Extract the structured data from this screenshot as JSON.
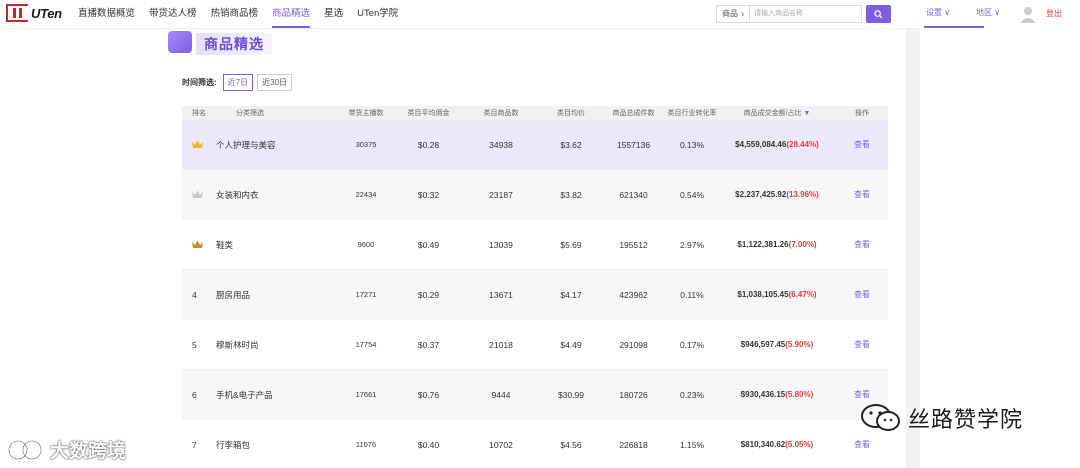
{
  "header": {
    "logo": "UTen",
    "nav": [
      "直播数据概览",
      "带货达人榜",
      "热销商品榜",
      "商品精选",
      "星选",
      "UTen学院"
    ],
    "nav_active_index": 3,
    "search_category": "商品",
    "search_placeholder": "请输入商品名称",
    "settings": "设置",
    "region": "地区",
    "logout": "登出"
  },
  "banner": {
    "title": "商品精选"
  },
  "time_filter": {
    "label": "时间筛选:",
    "options": [
      "近7日",
      "近30日"
    ],
    "active": "近7日"
  },
  "table": {
    "headers": [
      "排名",
      "分类筛选",
      "带货主播数",
      "类目平均佣金",
      "类目商品数",
      "类目均价",
      "商品总成件数",
      "类目行业转化率",
      "商品成交金额/占比",
      "操作"
    ],
    "rows": [
      {
        "rank": "",
        "rank_icon": "gold-crown-icon",
        "category": "个人护理与美容",
        "anchors": "30375",
        "commission": "$0.28",
        "goods": "34938",
        "avg_price": "$3.62",
        "units": "1557136",
        "conversion": "0.13%",
        "gmv": "$4,559,084.46",
        "share": "(28.44%)",
        "action": "查看"
      },
      {
        "rank": "",
        "rank_icon": "silver-crown-icon",
        "category": "女装和内衣",
        "anchors": "22434",
        "commission": "$0.32",
        "goods": "23187",
        "avg_price": "$3.82",
        "units": "621340",
        "conversion": "0.54%",
        "gmv": "$2,237,425.92",
        "share": "(13.96%)",
        "action": "查看"
      },
      {
        "rank": "",
        "rank_icon": "bronze-crown-icon",
        "category": "鞋类",
        "anchors": "9600",
        "commission": "$0.49",
        "goods": "13039",
        "avg_price": "$5.69",
        "units": "195512",
        "conversion": "2.97%",
        "gmv": "$1,122,381.26",
        "share": "(7.00%)",
        "action": "查看"
      },
      {
        "rank": "4",
        "rank_icon": "",
        "category": "厨房用品",
        "anchors": "17271",
        "commission": "$0.29",
        "goods": "13671",
        "avg_price": "$4.17",
        "units": "423962",
        "conversion": "0.11%",
        "gmv": "$1,038,105.45",
        "share": "(6.47%)",
        "action": "查看"
      },
      {
        "rank": "5",
        "rank_icon": "",
        "category": "穆斯林时尚",
        "anchors": "17754",
        "commission": "$0.37",
        "goods": "21018",
        "avg_price": "$4.49",
        "units": "291098",
        "conversion": "0.17%",
        "gmv": "$946,597.45",
        "share": "(5.90%)",
        "action": "查看"
      },
      {
        "rank": "6",
        "rank_icon": "",
        "category": "手机&电子产品",
        "anchors": "17661",
        "commission": "$0.76",
        "goods": "9444",
        "avg_price": "$30.99",
        "units": "180726",
        "conversion": "0.23%",
        "gmv": "$930,436.15",
        "share": "(5.80%)",
        "action": "查看"
      },
      {
        "rank": "7",
        "rank_icon": "",
        "category": "行李箱包",
        "anchors": "11076",
        "commission": "$0.40",
        "goods": "10702",
        "avg_price": "$4.56",
        "units": "226818",
        "conversion": "1.15%",
        "gmv": "$810,340.62",
        "share": "(5.05%)",
        "action": "查看"
      }
    ]
  },
  "watermarks": {
    "bottom_right": "丝路赞学院",
    "bottom_left": "大数跨境",
    "tile": "张翼飞 1029"
  },
  "colors": {
    "accent": "#7b5fe0",
    "highlight": "#e53a3a",
    "gold": "#f0b429",
    "silver": "#c8c8c8",
    "bronze": "#d08a36"
  }
}
